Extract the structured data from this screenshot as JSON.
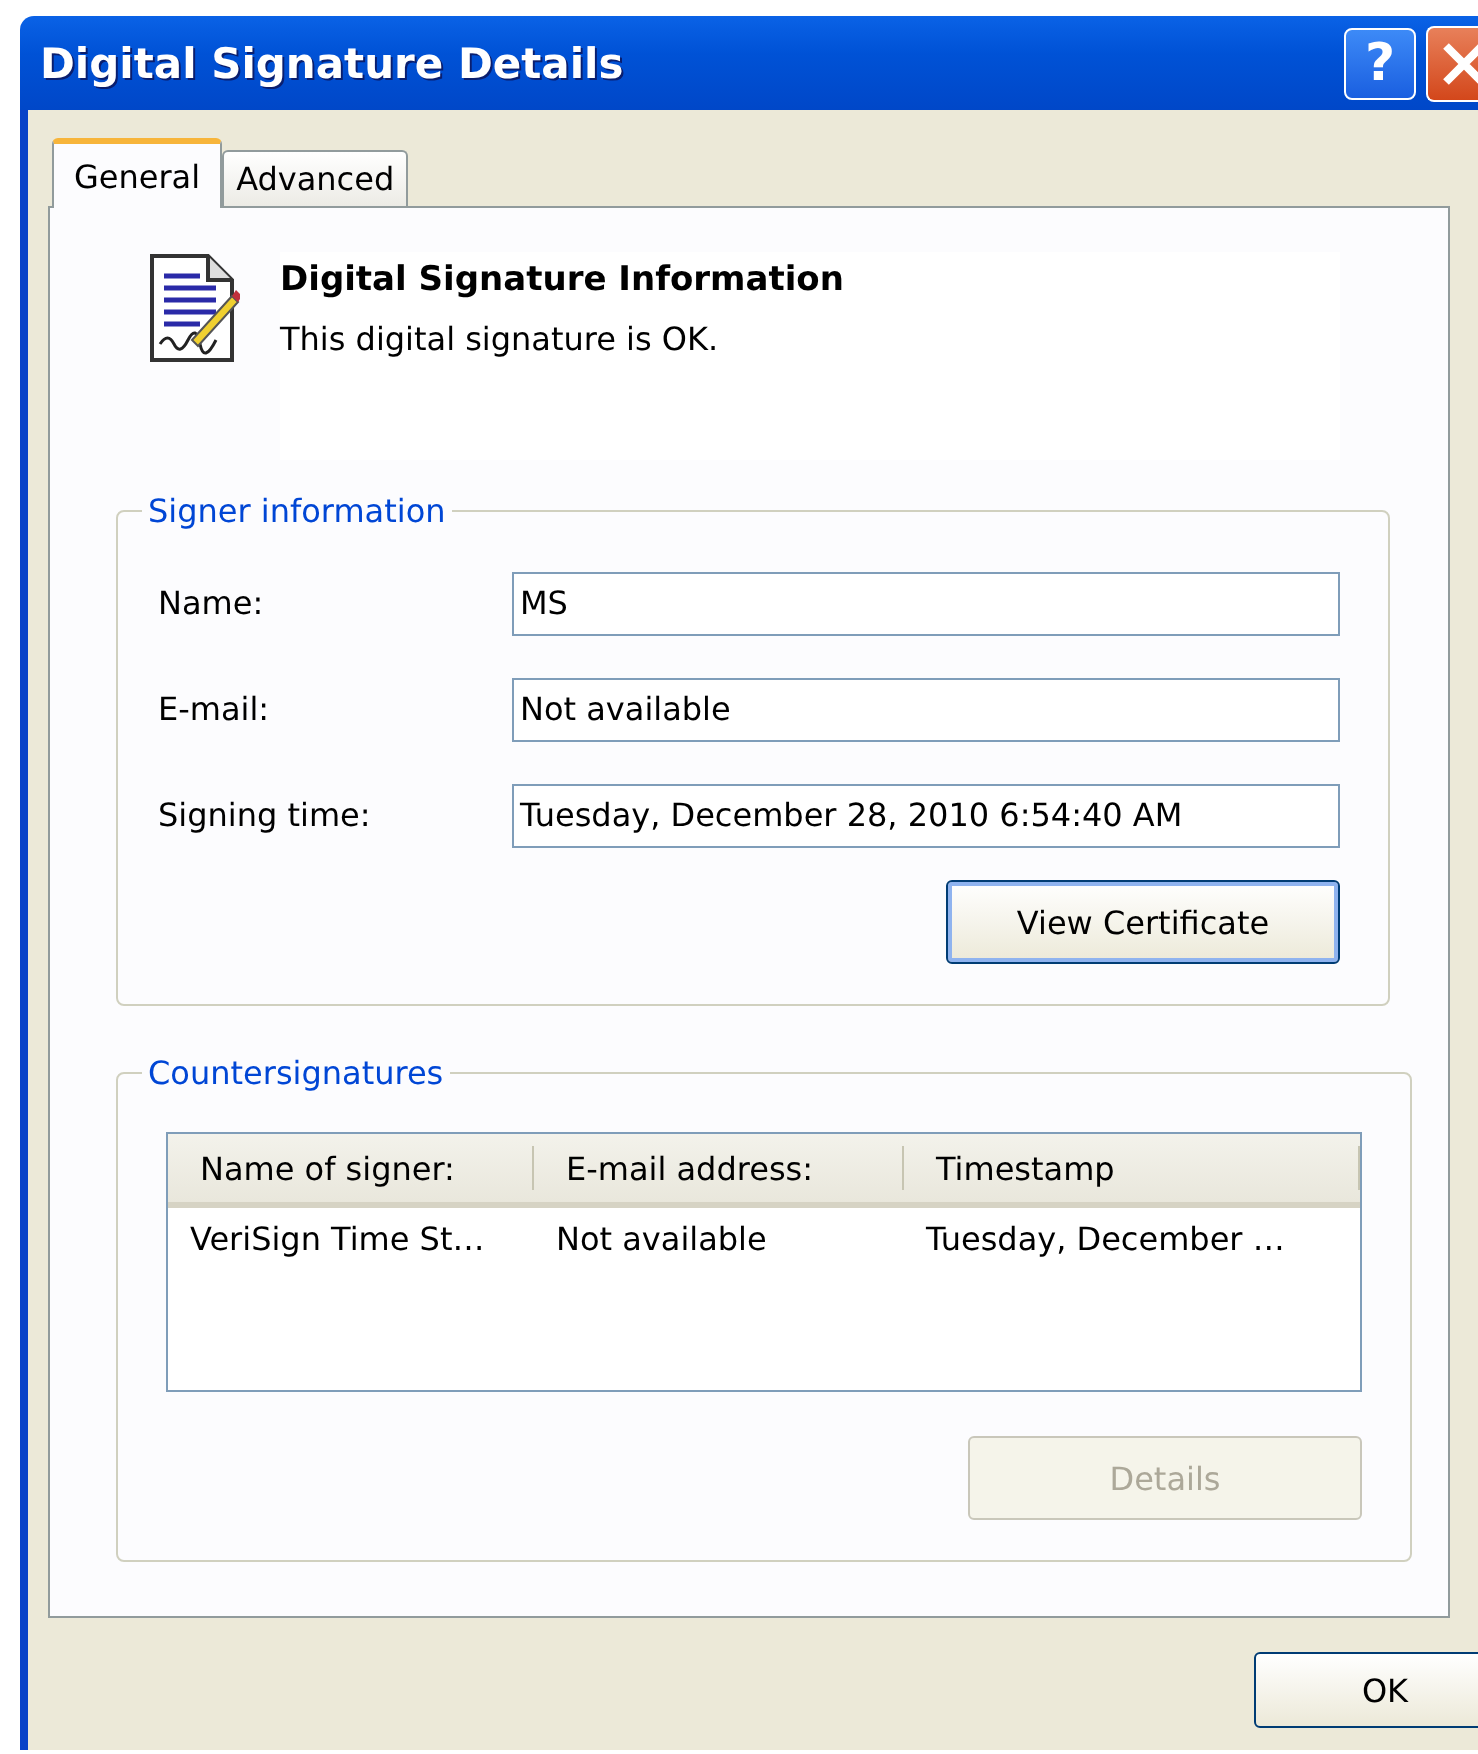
{
  "window": {
    "title": "Digital Signature Details",
    "help_button": "?"
  },
  "tabs": [
    {
      "label": "General",
      "selected": true
    },
    {
      "label": "Advanced",
      "selected": false
    }
  ],
  "info": {
    "title": "Digital Signature Information",
    "status": "This digital signature is OK."
  },
  "signer_information": {
    "legend": "Signer information",
    "fields": [
      {
        "label": "Name:",
        "value": "MS"
      },
      {
        "label": "E-mail:",
        "value": "Not available"
      },
      {
        "label": "Signing time:",
        "value": "Tuesday, December 28, 2010 6:54:40 AM"
      }
    ],
    "button": {
      "label": "View Certificate",
      "disabled": false,
      "default": true
    }
  },
  "countersignatures": {
    "legend": "Countersignatures",
    "columns": [
      "Name of signer:",
      "E-mail address:",
      "Timestamp"
    ],
    "rows": [
      {
        "cells": [
          "VeriSign Time St…",
          "Not available",
          "Tuesday, December …"
        ],
        "selected": false
      }
    ],
    "button": {
      "label": "Details",
      "disabled": true,
      "default": false
    }
  },
  "ok_button": {
    "label": "OK",
    "disabled": false,
    "default": false
  }
}
